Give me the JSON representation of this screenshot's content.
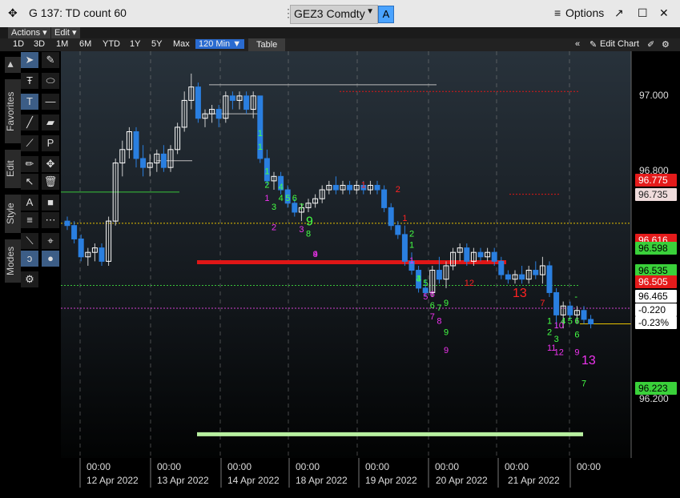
{
  "window": {
    "title": "G 137: TD count 60",
    "ticker": "GEZ3 Comdty",
    "badge": "A",
    "options_label": "Options"
  },
  "menu": {
    "actions": "Actions",
    "edit": "Edit"
  },
  "ranges": [
    "1D",
    "3D",
    "1M",
    "6M",
    "YTD",
    "1Y",
    "5Y",
    "Max"
  ],
  "interval": "120 Min",
  "table_label": "Table",
  "edit_chart_label": "Edit Chart",
  "side_tabs": [
    "Favorites",
    "Edit",
    "Style",
    "Modes"
  ],
  "colors": {
    "up_candle": "#ffffff",
    "down_candle": "#2a7fe0",
    "price_label_red": "#e51b1b",
    "price_label_green": "#3ad13a",
    "thick_red_line": "#ff1a1a",
    "thick_green_line": "#b8f0a0",
    "td_green": "#44ff44",
    "td_magenta": "#ee33ee",
    "td_red": "#ff2222"
  },
  "chart_data": {
    "type": "candlestick",
    "y_axis": {
      "range": [
        96.17,
        97.08
      ],
      "ticks": [
        "97.000",
        "96.800",
        "96.200"
      ]
    },
    "x_axis": {
      "time_labels": [
        "00:00",
        "00:00",
        "00:00",
        "00:00",
        "00:00",
        "00:00",
        "00:00",
        "00:00"
      ],
      "date_labels": [
        "12 Apr 2022",
        "13 Apr 2022",
        "14 Apr 2022",
        "18 Apr 2022",
        "19 Apr 2022",
        "20 Apr 2022",
        "21 Apr 2022"
      ]
    },
    "price_labels": [
      {
        "text": "96.775",
        "color": "red"
      },
      {
        "text": "96.735",
        "color": "light"
      },
      {
        "text": "96.616",
        "color": "red"
      },
      {
        "text": "96.598",
        "color": "green"
      },
      {
        "text": "96.535",
        "color": "green"
      },
      {
        "text": "96.505",
        "color": "red"
      },
      {
        "text": "96.465",
        "color": "white"
      },
      {
        "text": "-0.220",
        "color": "white"
      },
      {
        "text": "-0.23%",
        "color": "white"
      },
      {
        "text": "96.223",
        "color": "green"
      }
    ],
    "levels": [
      {
        "value": 96.608,
        "style": "thick",
        "color": "red"
      },
      {
        "value": 96.223,
        "style": "thick",
        "color": "lightgreen"
      },
      {
        "value": 96.695,
        "style": "dotted",
        "color": "yellow"
      },
      {
        "value": 96.556,
        "style": "dotted",
        "color": "green"
      },
      {
        "value": 96.47,
        "style": "solid",
        "color": "yellow"
      },
      {
        "value": 96.765,
        "style": "solid",
        "color": "green"
      },
      {
        "value": 96.835,
        "style": "solid",
        "color": "white"
      },
      {
        "value": 96.94,
        "style": "solid",
        "color": "white"
      },
      {
        "value": 97.005,
        "style": "solid",
        "color": "white"
      },
      {
        "value": 96.99,
        "style": "dotted",
        "color": "red"
      },
      {
        "value": 96.76,
        "style": "dotted",
        "color": "red"
      },
      {
        "value": 96.505,
        "style": "dotted",
        "color": "magenta"
      }
    ],
    "candles": [
      {
        "o": 96.7,
        "h": 96.71,
        "l": 96.68,
        "c": 96.69
      },
      {
        "o": 96.69,
        "h": 96.7,
        "l": 96.65,
        "c": 96.66
      },
      {
        "o": 96.66,
        "h": 96.67,
        "l": 96.61,
        "c": 96.62
      },
      {
        "o": 96.62,
        "h": 96.64,
        "l": 96.6,
        "c": 96.63
      },
      {
        "o": 96.63,
        "h": 96.65,
        "l": 96.61,
        "c": 96.64
      },
      {
        "o": 96.64,
        "h": 96.65,
        "l": 96.6,
        "c": 96.61
      },
      {
        "o": 96.61,
        "h": 96.71,
        "l": 96.6,
        "c": 96.7
      },
      {
        "o": 96.7,
        "h": 96.84,
        "l": 96.69,
        "c": 96.83
      },
      {
        "o": 96.83,
        "h": 96.88,
        "l": 96.8,
        "c": 96.86
      },
      {
        "o": 96.86,
        "h": 96.91,
        "l": 96.84,
        "c": 96.9
      },
      {
        "o": 96.9,
        "h": 96.91,
        "l": 96.82,
        "c": 96.84
      },
      {
        "o": 96.84,
        "h": 96.87,
        "l": 96.8,
        "c": 96.82
      },
      {
        "o": 96.82,
        "h": 96.85,
        "l": 96.8,
        "c": 96.83
      },
      {
        "o": 96.83,
        "h": 96.86,
        "l": 96.81,
        "c": 96.85
      },
      {
        "o": 96.85,
        "h": 96.87,
        "l": 96.81,
        "c": 96.82
      },
      {
        "o": 96.82,
        "h": 96.87,
        "l": 96.81,
        "c": 96.86
      },
      {
        "o": 96.86,
        "h": 96.92,
        "l": 96.85,
        "c": 96.91
      },
      {
        "o": 96.91,
        "h": 96.99,
        "l": 96.9,
        "c": 96.97
      },
      {
        "o": 96.97,
        "h": 97.03,
        "l": 96.95,
        "c": 97.0
      },
      {
        "o": 97.0,
        "h": 97.01,
        "l": 96.92,
        "c": 96.93
      },
      {
        "o": 96.93,
        "h": 96.95,
        "l": 96.91,
        "c": 96.94
      },
      {
        "o": 96.94,
        "h": 96.96,
        "l": 96.92,
        "c": 96.95
      },
      {
        "o": 96.95,
        "h": 96.96,
        "l": 96.91,
        "c": 96.93
      },
      {
        "o": 96.93,
        "h": 96.99,
        "l": 96.92,
        "c": 96.98
      },
      {
        "o": 96.98,
        "h": 96.99,
        "l": 96.95,
        "c": 96.97
      },
      {
        "o": 96.97,
        "h": 96.99,
        "l": 96.95,
        "c": 96.98
      },
      {
        "o": 96.98,
        "h": 96.99,
        "l": 96.94,
        "c": 96.95
      },
      {
        "o": 96.95,
        "h": 96.99,
        "l": 96.93,
        "c": 96.98
      },
      {
        "o": 96.98,
        "h": 96.98,
        "l": 96.83,
        "c": 96.84
      },
      {
        "o": 96.84,
        "h": 96.86,
        "l": 96.78,
        "c": 96.79
      },
      {
        "o": 96.79,
        "h": 96.81,
        "l": 96.77,
        "c": 96.8
      },
      {
        "o": 96.8,
        "h": 96.81,
        "l": 96.76,
        "c": 96.77
      },
      {
        "o": 96.77,
        "h": 96.78,
        "l": 96.73,
        "c": 96.74
      },
      {
        "o": 96.74,
        "h": 96.75,
        "l": 96.71,
        "c": 96.72
      },
      {
        "o": 96.72,
        "h": 96.74,
        "l": 96.7,
        "c": 96.73
      },
      {
        "o": 96.73,
        "h": 96.75,
        "l": 96.72,
        "c": 96.74
      },
      {
        "o": 96.74,
        "h": 96.76,
        "l": 96.73,
        "c": 96.75
      },
      {
        "o": 96.75,
        "h": 96.78,
        "l": 96.74,
        "c": 96.77
      },
      {
        "o": 96.77,
        "h": 96.79,
        "l": 96.76,
        "c": 96.78
      },
      {
        "o": 96.78,
        "h": 96.8,
        "l": 96.76,
        "c": 96.77
      },
      {
        "o": 96.77,
        "h": 96.79,
        "l": 96.76,
        "c": 96.78
      },
      {
        "o": 96.78,
        "h": 96.79,
        "l": 96.76,
        "c": 96.77
      },
      {
        "o": 96.77,
        "h": 96.79,
        "l": 96.76,
        "c": 96.78
      },
      {
        "o": 96.78,
        "h": 96.79,
        "l": 96.76,
        "c": 96.77
      },
      {
        "o": 96.77,
        "h": 96.79,
        "l": 96.76,
        "c": 96.78
      },
      {
        "o": 96.78,
        "h": 96.79,
        "l": 96.76,
        "c": 96.77
      },
      {
        "o": 96.77,
        "h": 96.78,
        "l": 96.72,
        "c": 96.73
      },
      {
        "o": 96.73,
        "h": 96.74,
        "l": 96.68,
        "c": 96.69
      },
      {
        "o": 96.69,
        "h": 96.7,
        "l": 96.66,
        "c": 96.67
      },
      {
        "o": 96.67,
        "h": 96.69,
        "l": 96.6,
        "c": 96.61
      },
      {
        "o": 96.61,
        "h": 96.63,
        "l": 96.58,
        "c": 96.59
      },
      {
        "o": 96.59,
        "h": 96.6,
        "l": 96.54,
        "c": 96.55
      },
      {
        "o": 96.55,
        "h": 96.57,
        "l": 96.53,
        "c": 96.54
      },
      {
        "o": 96.54,
        "h": 96.6,
        "l": 96.53,
        "c": 96.59
      },
      {
        "o": 96.59,
        "h": 96.62,
        "l": 96.56,
        "c": 96.57
      },
      {
        "o": 96.57,
        "h": 96.61,
        "l": 96.55,
        "c": 96.6
      },
      {
        "o": 96.6,
        "h": 96.64,
        "l": 96.59,
        "c": 96.63
      },
      {
        "o": 96.63,
        "h": 96.65,
        "l": 96.61,
        "c": 96.64
      },
      {
        "o": 96.64,
        "h": 96.65,
        "l": 96.6,
        "c": 96.61
      },
      {
        "o": 96.61,
        "h": 96.64,
        "l": 96.6,
        "c": 96.63
      },
      {
        "o": 96.63,
        "h": 96.64,
        "l": 96.61,
        "c": 96.62
      },
      {
        "o": 96.62,
        "h": 96.64,
        "l": 96.61,
        "c": 96.63
      },
      {
        "o": 96.63,
        "h": 96.64,
        "l": 96.6,
        "c": 96.61
      },
      {
        "o": 96.61,
        "h": 96.62,
        "l": 96.57,
        "c": 96.58
      },
      {
        "o": 96.58,
        "h": 96.59,
        "l": 96.56,
        "c": 96.57
      },
      {
        "o": 96.57,
        "h": 96.59,
        "l": 96.56,
        "c": 96.58
      },
      {
        "o": 96.58,
        "h": 96.6,
        "l": 96.56,
        "c": 96.57
      },
      {
        "o": 96.57,
        "h": 96.6,
        "l": 96.56,
        "c": 96.59
      },
      {
        "o": 96.59,
        "h": 96.61,
        "l": 96.57,
        "c": 96.58
      },
      {
        "o": 96.58,
        "h": 96.62,
        "l": 96.56,
        "c": 96.6
      },
      {
        "o": 96.6,
        "h": 96.61,
        "l": 96.53,
        "c": 96.54
      },
      {
        "o": 96.54,
        "h": 96.55,
        "l": 96.46,
        "c": 96.49
      },
      {
        "o": 96.49,
        "h": 96.52,
        "l": 96.46,
        "c": 96.51
      },
      {
        "o": 96.51,
        "h": 96.52,
        "l": 96.48,
        "c": 96.49
      },
      {
        "o": 96.49,
        "h": 96.51,
        "l": 96.47,
        "c": 96.5
      },
      {
        "o": 96.5,
        "h": 96.51,
        "l": 96.47,
        "c": 96.48
      },
      {
        "o": 96.48,
        "h": 96.49,
        "l": 96.46,
        "c": 96.47
      }
    ],
    "td_labels": [
      {
        "i": 28,
        "v": 96.89,
        "t": "1",
        "c": "g"
      },
      {
        "i": 28,
        "v": 96.86,
        "t": "1",
        "c": "g"
      },
      {
        "i": 29,
        "v": 96.805,
        "t": "1",
        "c": "g"
      },
      {
        "i": 29,
        "v": 96.775,
        "t": "2",
        "c": "g"
      },
      {
        "i": 29,
        "v": 96.745,
        "t": "1",
        "c": "m"
      },
      {
        "i": 30,
        "v": 96.725,
        "t": "3",
        "c": "g"
      },
      {
        "i": 30,
        "v": 96.68,
        "t": "2",
        "c": "m"
      },
      {
        "i": 31,
        "v": 96.77,
        "t": "4",
        "c": "g"
      },
      {
        "i": 31,
        "v": 96.745,
        "t": "4",
        "c": "g"
      },
      {
        "i": 32,
        "v": 96.745,
        "t": "5",
        "c": "g"
      },
      {
        "i": 33,
        "v": 96.745,
        "t": "6",
        "c": "g"
      },
      {
        "i": 34,
        "v": 96.725,
        "t": "7",
        "c": "g"
      },
      {
        "i": 34,
        "v": 96.675,
        "t": "3",
        "c": "m"
      },
      {
        "i": 35,
        "v": 96.69,
        "t": "9",
        "c": "g"
      },
      {
        "i": 35,
        "v": 96.665,
        "t": "8",
        "c": "g"
      },
      {
        "i": 36,
        "v": 96.62,
        "t": "4",
        "c": "m"
      },
      {
        "i": 36,
        "v": 96.62,
        "t": "9",
        "c": "m"
      },
      {
        "i": 43,
        "v": 96.775,
        "t": "1",
        "c": "r"
      },
      {
        "i": 48,
        "v": 96.765,
        "t": "2",
        "c": "r"
      },
      {
        "i": 49,
        "v": 96.7,
        "t": "1",
        "c": "r"
      },
      {
        "i": 50,
        "v": 96.665,
        "t": "2",
        "c": "g"
      },
      {
        "i": 50,
        "v": 96.64,
        "t": "1",
        "c": "g"
      },
      {
        "i": 50,
        "v": 96.605,
        "t": "1",
        "c": "m"
      },
      {
        "i": 51,
        "v": 96.565,
        "t": "3",
        "c": "g"
      },
      {
        "i": 51,
        "v": 96.565,
        "t": "4",
        "c": "g"
      },
      {
        "i": 52,
        "v": 96.555,
        "t": "5",
        "c": "g"
      },
      {
        "i": 52,
        "v": 96.525,
        "t": "5",
        "c": "m"
      },
      {
        "i": 53,
        "v": 96.505,
        "t": "6",
        "c": "g"
      },
      {
        "i": 53,
        "v": 96.53,
        "t": "6",
        "c": "m"
      },
      {
        "i": 53,
        "v": 96.48,
        "t": "7",
        "c": "m"
      },
      {
        "i": 54,
        "v": 96.5,
        "t": "7",
        "c": "g"
      },
      {
        "i": 54,
        "v": 96.47,
        "t": "8",
        "c": "m"
      },
      {
        "i": 55,
        "v": 96.51,
        "t": "9",
        "c": "g"
      },
      {
        "i": 55,
        "v": 96.445,
        "t": "9",
        "c": "g"
      },
      {
        "i": 55,
        "v": 96.405,
        "t": "9",
        "c": "m"
      },
      {
        "i": 58,
        "v": 96.555,
        "t": "12",
        "c": "r"
      },
      {
        "i": 65,
        "v": 96.53,
        "t": "13",
        "c": "r"
      },
      {
        "i": 69,
        "v": 96.51,
        "t": "7",
        "c": "r"
      },
      {
        "i": 70,
        "v": 96.47,
        "t": "1",
        "c": "g"
      },
      {
        "i": 70,
        "v": 96.445,
        "t": "2",
        "c": "g"
      },
      {
        "i": 70,
        "v": 96.41,
        "t": "11",
        "c": "m"
      },
      {
        "i": 71,
        "v": 96.46,
        "t": "10",
        "c": "m"
      },
      {
        "i": 71,
        "v": 96.43,
        "t": "3",
        "c": "g"
      },
      {
        "i": 71,
        "v": 96.4,
        "t": "12",
        "c": "m"
      },
      {
        "i": 72,
        "v": 96.47,
        "t": "4",
        "c": "g"
      },
      {
        "i": 73,
        "v": 96.47,
        "t": "5",
        "c": "g"
      },
      {
        "i": 74,
        "v": 96.47,
        "t": "6",
        "c": "g"
      },
      {
        "i": 74,
        "v": 96.525,
        "t": "-",
        "c": "g"
      },
      {
        "i": 74,
        "v": 96.44,
        "t": "6",
        "c": "g"
      },
      {
        "i": 74,
        "v": 96.4,
        "t": "9",
        "c": "m"
      },
      {
        "i": 75,
        "v": 96.38,
        "t": "13",
        "c": "m"
      },
      {
        "i": 75,
        "v": 96.33,
        "t": "7",
        "c": "g"
      }
    ]
  }
}
